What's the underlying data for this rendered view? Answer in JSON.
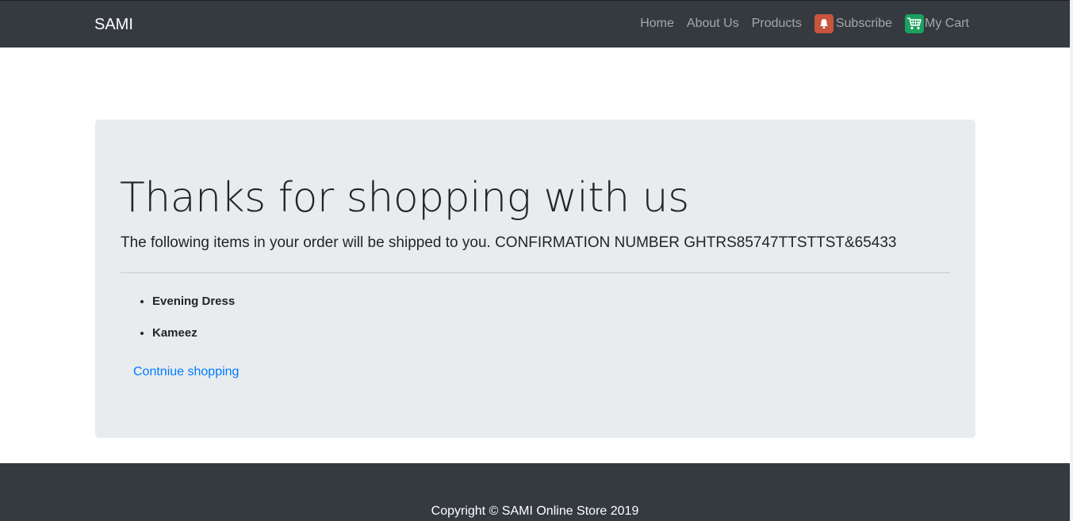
{
  "navbar": {
    "brand": "SAMI",
    "links": {
      "home": "Home",
      "about": "About Us",
      "products": "Products",
      "subscribe": "Subscribe",
      "cart": "My Cart"
    },
    "icons": {
      "subscribe": "bell-icon",
      "cart": "cart-icon"
    }
  },
  "main": {
    "headline": "Thanks for shopping with us",
    "lead_text": "The following items in your order will be shipped to you.",
    "confirmation": "CONFIRMATION NUMBER GHTRS85747TTSTTST&65433",
    "items": [
      "Evening Dress",
      "Kameez"
    ],
    "continue_link": "Contniue shopping"
  },
  "footer": {
    "copyright": "Copyright © SAMI Online Store 2019"
  },
  "colors": {
    "navbar_bg": "#343a40",
    "jumbotron_bg": "#e9ecef",
    "link": "#007bff",
    "subscribe_icon_bg": "#c8553d",
    "cart_icon_bg": "#1aa260"
  }
}
